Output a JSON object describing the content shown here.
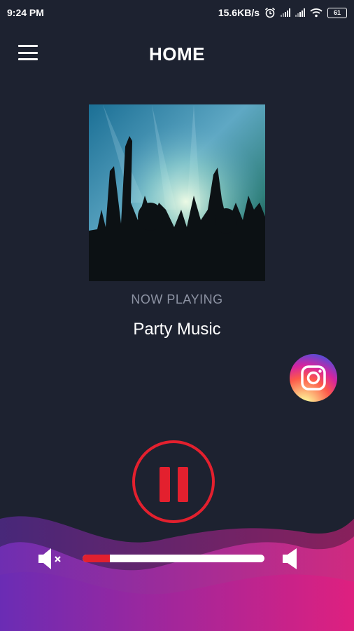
{
  "status_bar": {
    "time": "9:24 PM",
    "network_speed": "15.6KB/s",
    "battery": "61",
    "icons": [
      "alarm-icon",
      "signal-icon",
      "signal-icon",
      "wifi-icon",
      "battery-icon"
    ]
  },
  "header": {
    "title": "HOME",
    "menu_icon": "hamburger-menu-icon"
  },
  "player": {
    "now_playing_label": "NOW PLAYING",
    "track_title": "Party Music",
    "state": "playing",
    "control_icon": "pause-icon",
    "volume": 0.15
  },
  "social": {
    "icon": "instagram-icon"
  },
  "colors": {
    "background": "#1d2230",
    "accent": "#e3202e",
    "muted_text": "#8d93a3",
    "wave_start": "#6a2cb5",
    "wave_end": "#e01f7f"
  }
}
